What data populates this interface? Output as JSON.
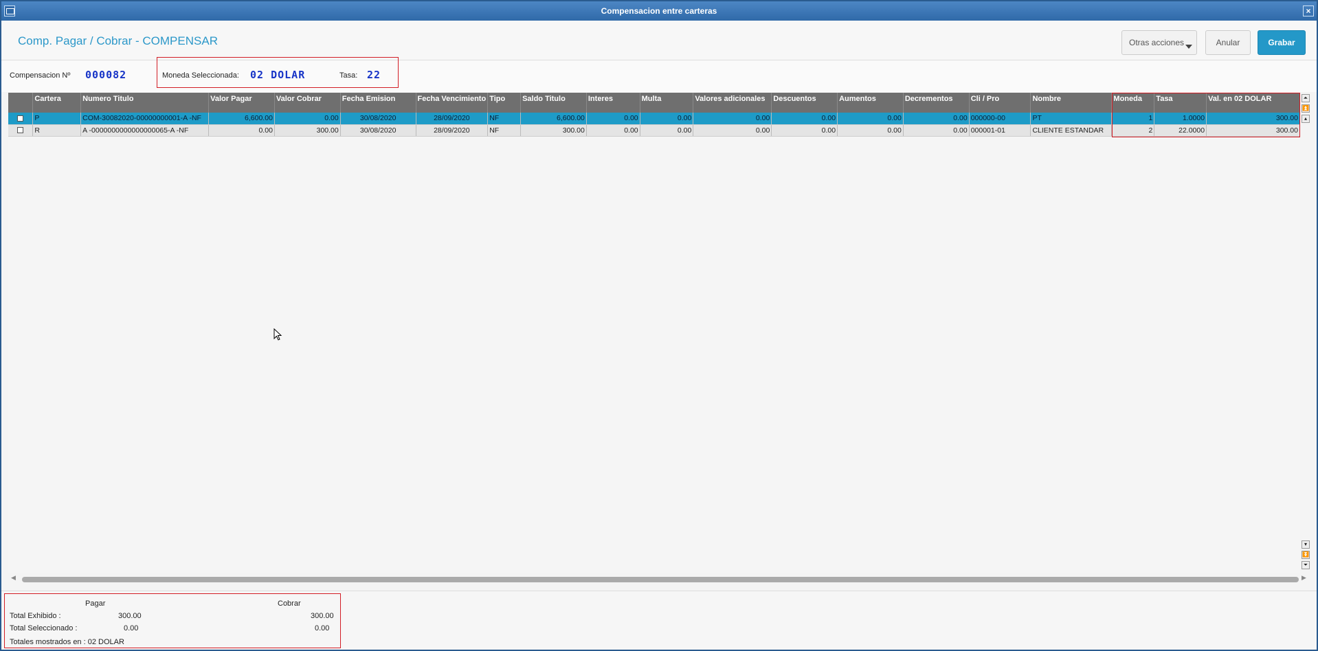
{
  "window": {
    "title": "Compensacion entre carteras",
    "close_glyph": "×"
  },
  "header": {
    "title": "Comp. Pagar / Cobrar - COMPENSAR",
    "buttons": {
      "otras": "Otras acciones",
      "anular": "Anular",
      "grabar": "Grabar"
    }
  },
  "info": {
    "comp_label": "Compensacion Nº",
    "comp_number": "000082",
    "moneda_label": "Moneda Seleccionada:",
    "moneda_value": "02 DOLAR",
    "tasa_label": "Tasa:",
    "tasa_value": "22"
  },
  "grid": {
    "columns": [
      "",
      "Cartera",
      "Numero Titulo",
      "Valor Pagar",
      "Valor Cobrar",
      "Fecha Emision",
      "Fecha Vencimiento",
      "Tipo",
      "Saldo Titulo",
      "Interes",
      "Multa",
      "Valores adicionales",
      "Descuentos",
      "Aumentos",
      "Decrementos",
      "Cli / Pro",
      "Nombre",
      "Moneda",
      "Tasa",
      "Val. en 02 DOLAR"
    ],
    "rows": [
      [
        "P",
        "COM-30082020-00000000001-A -NF",
        "6,600.00",
        "0.00",
        "30/08/2020",
        "28/09/2020",
        "NF",
        "6,600.00",
        "0.00",
        "0.00",
        "0.00",
        "0.00",
        "0.00",
        "0.00",
        "000000-00",
        "PT",
        "1",
        "1.0000",
        "300.00"
      ],
      [
        "R",
        "A  -0000000000000000065-A -NF",
        "0.00",
        "300.00",
        "30/08/2020",
        "28/09/2020",
        "NF",
        "300.00",
        "0.00",
        "0.00",
        "0.00",
        "0.00",
        "0.00",
        "0.00",
        "000001-01",
        "CLIENTE ESTANDAR",
        "2",
        "22.0000",
        "300.00"
      ]
    ],
    "selected_row": 0
  },
  "totals": {
    "pagar_header": "Pagar",
    "cobrar_header": "Cobrar",
    "exhibido_label": "Total Exhibido :",
    "exhibido_pagar": "300.00",
    "exhibido_cobrar": "300.00",
    "seleccionado_label": "Total Seleccionado :",
    "seleccionado_pagar": "0.00",
    "seleccionado_cobrar": "0.00",
    "mostrados": "Totales mostrados en : 02 DOLAR"
  },
  "colors": {
    "accent": "#2498c8",
    "highlight_border": "#d21c24",
    "selected_row": "#1e9bc7"
  }
}
